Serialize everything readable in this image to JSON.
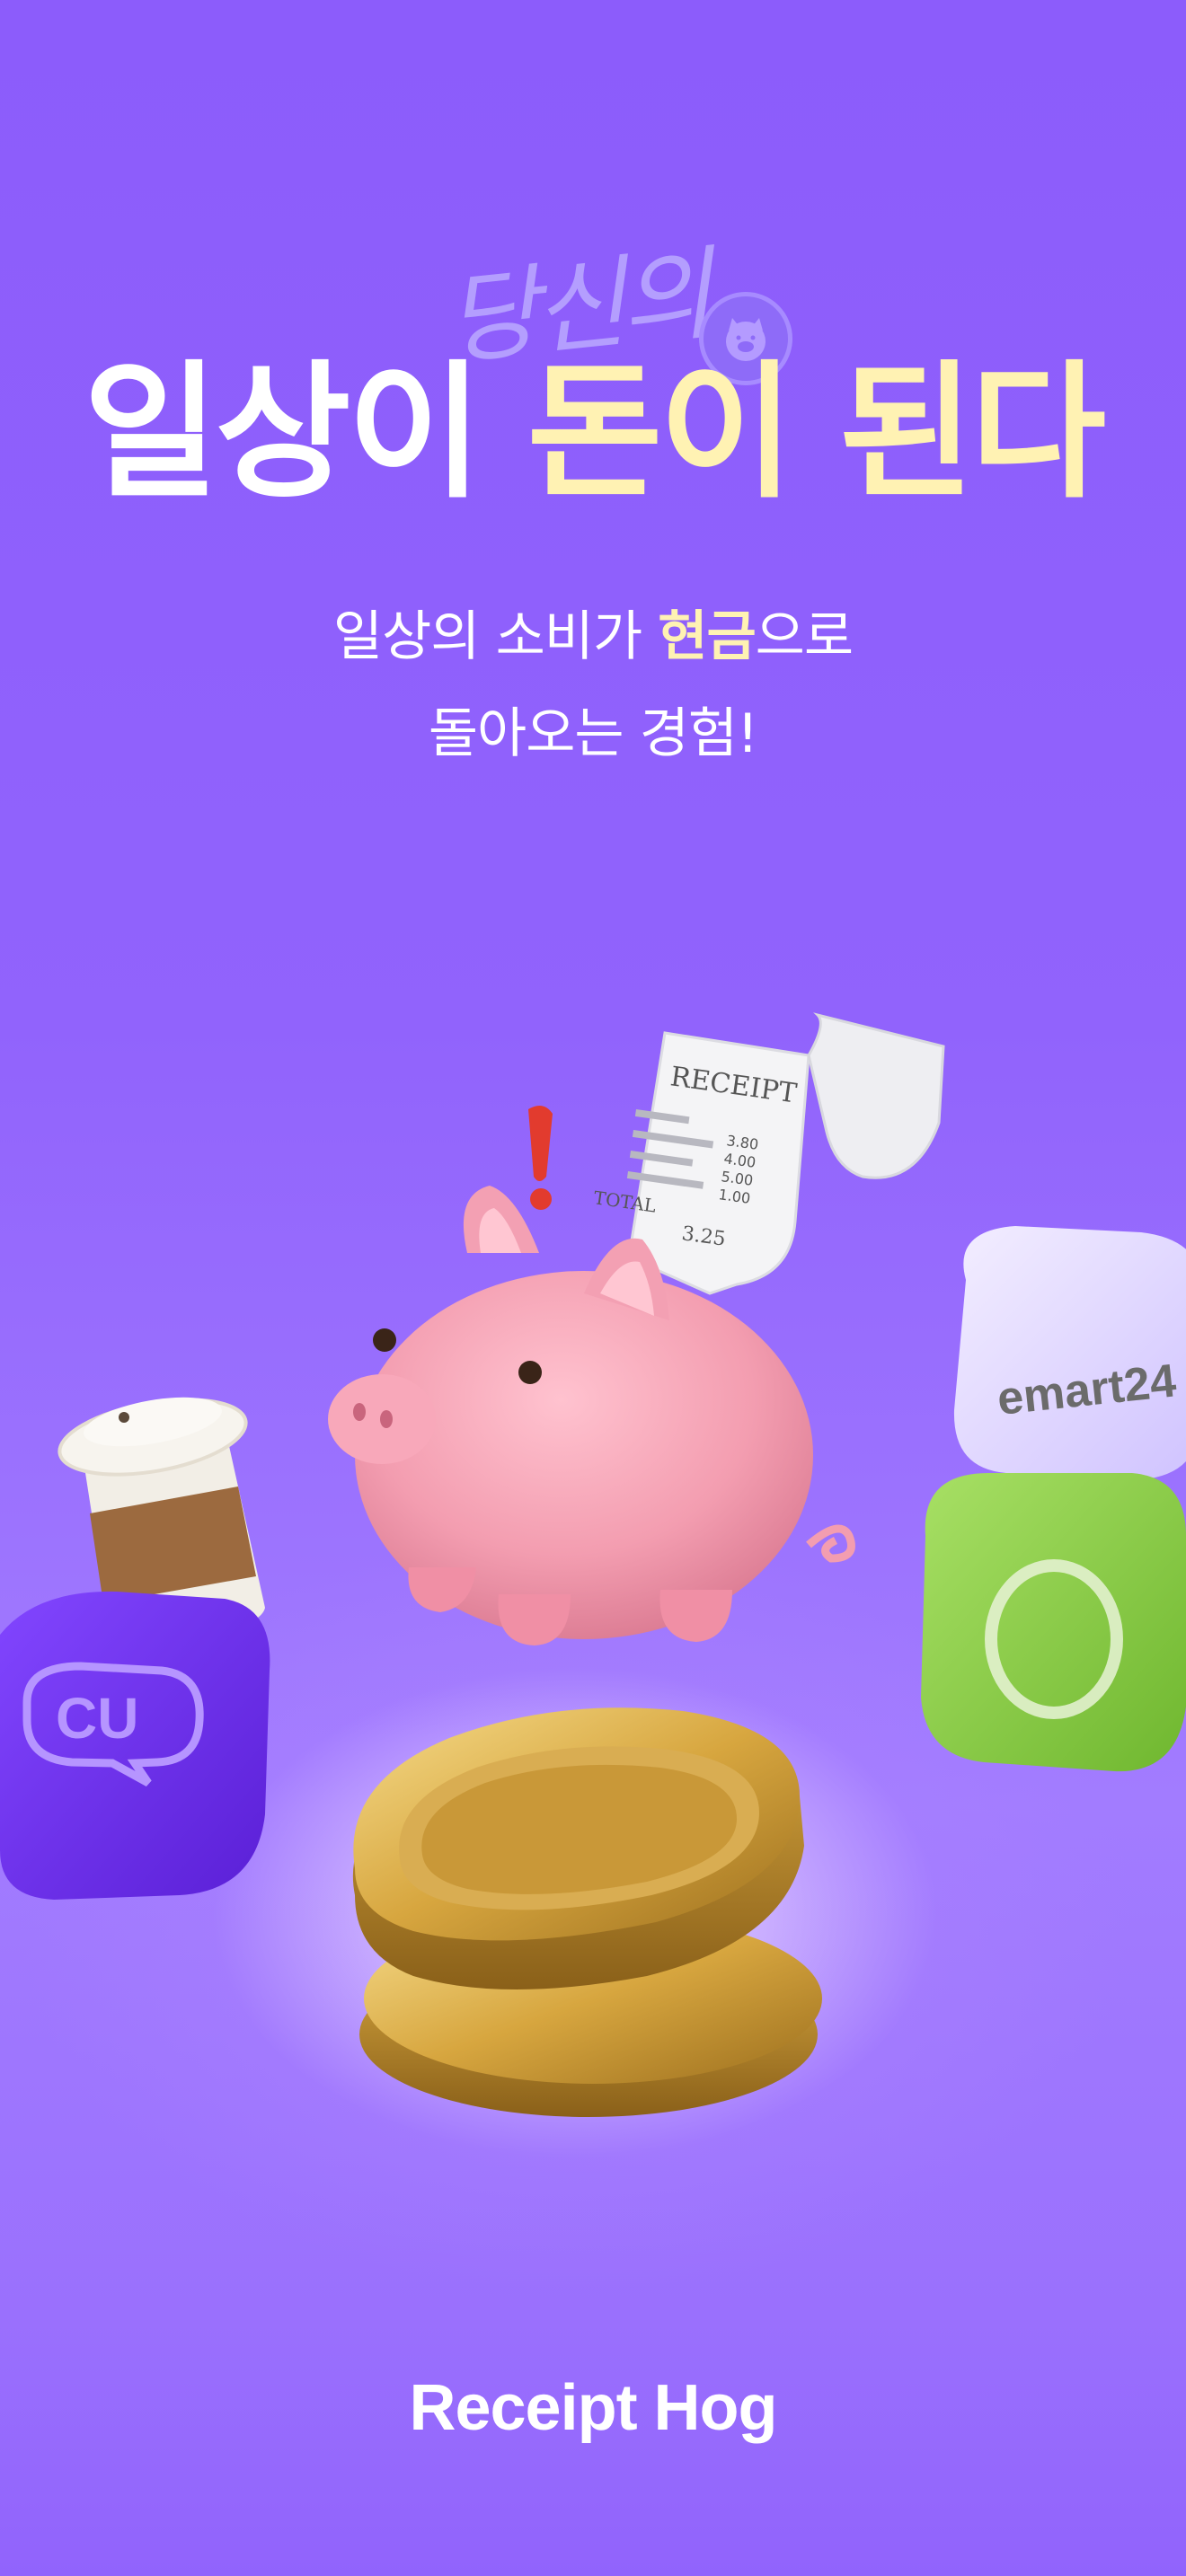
{
  "headline": {
    "script_word": "당신의",
    "part1": "일상이 ",
    "part2_highlight": "돈이 된다"
  },
  "subtitle": {
    "line1_prefix": "일상의 소비가 ",
    "line1_highlight": "현금",
    "line1_suffix": "으로",
    "line2": "돌아오는 경험!"
  },
  "receipt": {
    "title": "RECEIPT",
    "amounts": [
      "3.80",
      "4.00",
      "5.00",
      "1.00"
    ],
    "total_label": "TOTAL",
    "total_value": "3.25"
  },
  "store_badges": {
    "emart24": "emart24",
    "cu": "CU",
    "olive_young": "O"
  },
  "footer": {
    "brand": "Receipt Hog"
  },
  "colors": {
    "background": "#9163fc",
    "highlight": "#fff2b3",
    "text": "#ffffff"
  }
}
